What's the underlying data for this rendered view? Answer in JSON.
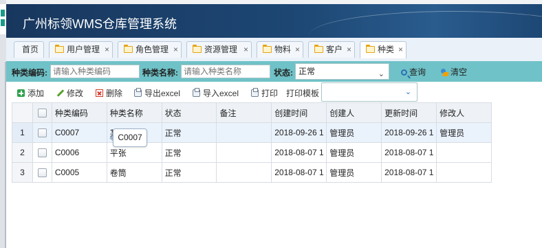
{
  "header": {
    "title": "广州标领WMS仓库管理系统"
  },
  "tabs": [
    {
      "label": "首页",
      "closable": false,
      "active": false
    },
    {
      "label": "用户管理",
      "closable": true,
      "active": false
    },
    {
      "label": "角色管理",
      "closable": true,
      "active": false
    },
    {
      "label": "资源管理",
      "closable": true,
      "active": false
    },
    {
      "label": "物料",
      "closable": true,
      "active": false
    },
    {
      "label": "客户",
      "closable": true,
      "active": false
    },
    {
      "label": "种类",
      "closable": true,
      "active": true
    }
  ],
  "tab_close_glyph": "×",
  "filter": {
    "code_label": "种类编码:",
    "code_placeholder": "请输入种类编码",
    "name_label": "种类名称:",
    "name_placeholder": "请输入种类名称",
    "status_label": "状态:",
    "status_value": "正常",
    "search_label": "查询",
    "clear_label": "清空"
  },
  "toolbar": {
    "add": "添加",
    "edit": "修改",
    "delete": "删除",
    "export": "导出excel",
    "import": "导入excel",
    "print": "打印",
    "print_template_label": "打印模板",
    "print_template_value": ""
  },
  "grid": {
    "columns": [
      "种类编码",
      "种类名称",
      "状态",
      "备注",
      "创建时间",
      "创建人",
      "更新时间",
      "修改人"
    ],
    "rows": [
      {
        "num": "1",
        "code": "C0007",
        "name": "某",
        "status": "正常",
        "remark": "",
        "created": "2018-09-26 1",
        "creator": "管理员",
        "updated": "2018-09-26 1",
        "modifier": "管理员"
      },
      {
        "num": "2",
        "code": "C0006",
        "name": "平张",
        "status": "正常",
        "remark": "",
        "created": "2018-08-07 1",
        "creator": "管理员",
        "updated": "2018-08-07 1",
        "modifier": ""
      },
      {
        "num": "3",
        "code": "C0005",
        "name": "卷筒",
        "status": "正常",
        "remark": "",
        "created": "2018-08-07 1",
        "creator": "管理员",
        "updated": "2018-08-07 1",
        "modifier": ""
      }
    ]
  },
  "tooltip": {
    "text": "C0007"
  },
  "colors": {
    "header_bg": "#1d4774",
    "filter_bg": "#6fc2c7",
    "row_highlight": "#eaf2fc",
    "folder_icon": "#e6a413"
  },
  "icons": [
    "folder-icon",
    "search-icon",
    "clear-icon",
    "add-icon",
    "edit-icon",
    "delete-icon",
    "excel-export-icon",
    "excel-import-icon",
    "print-icon",
    "chevron-down-icon"
  ]
}
